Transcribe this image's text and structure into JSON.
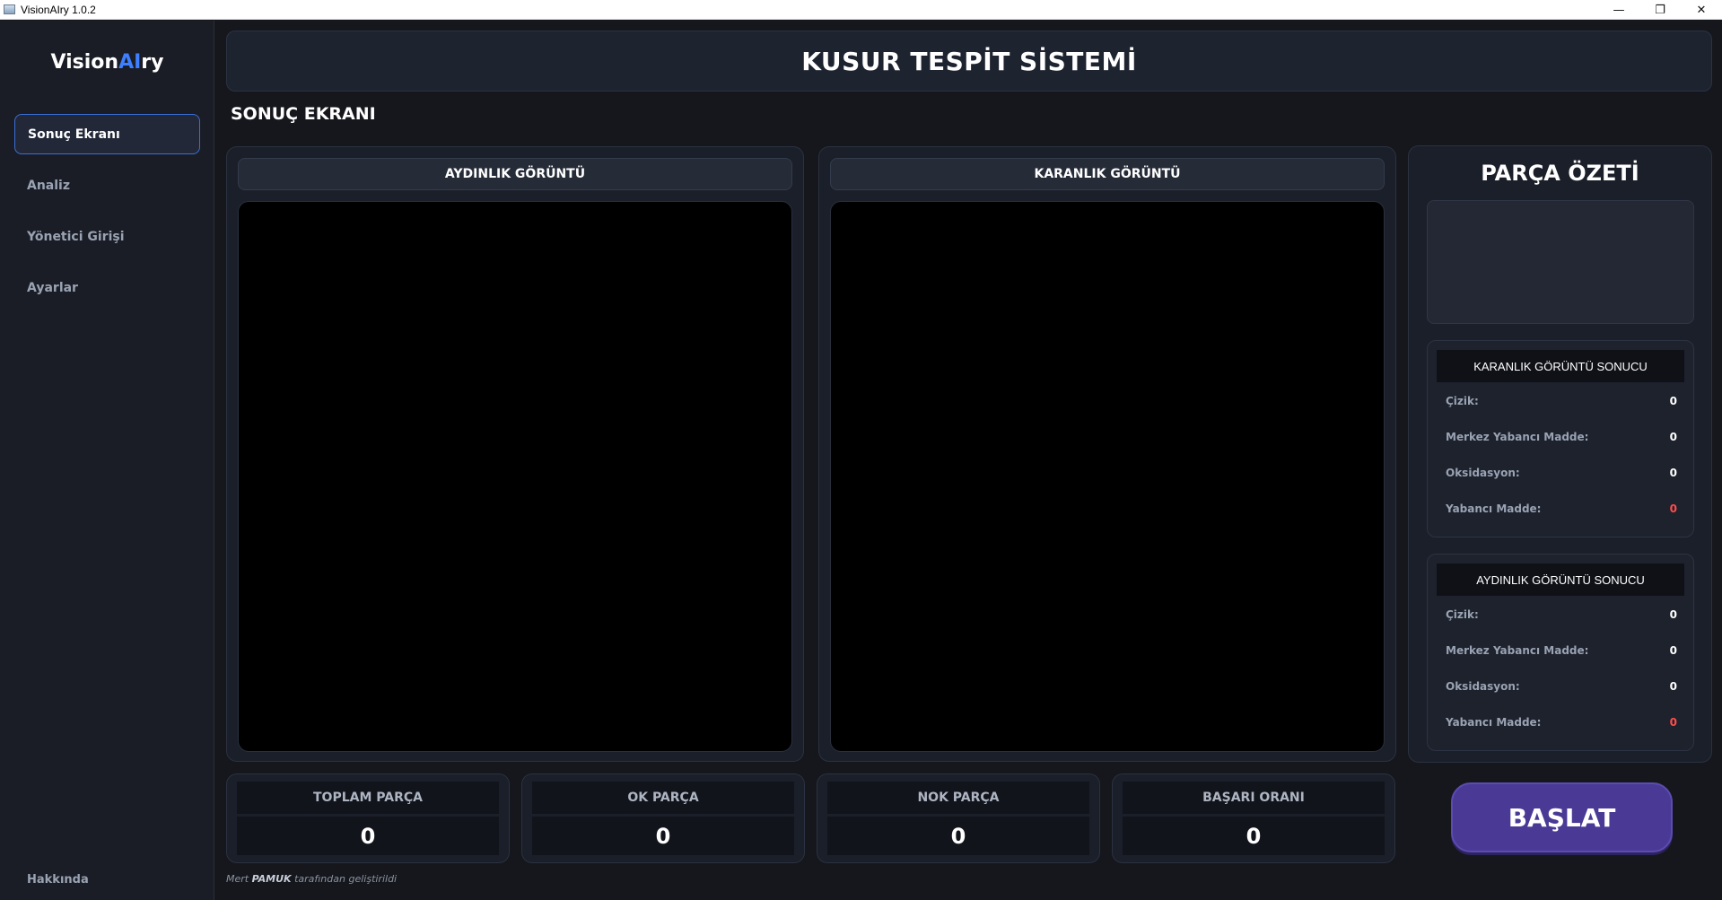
{
  "window": {
    "title": "VisionAIry 1.0.2",
    "controls": {
      "minimize": "—",
      "maximize": "❐",
      "close": "✕"
    }
  },
  "sidebar": {
    "brand_prefix": "Vision",
    "brand_ai": "AI",
    "brand_suffix": "ry",
    "items": [
      {
        "label": "Sonuç Ekranı",
        "active": true
      },
      {
        "label": "Analiz",
        "active": false
      },
      {
        "label": "Yönetici Girişi",
        "active": false
      },
      {
        "label": "Ayarlar",
        "active": false
      }
    ],
    "about": "Hakkında"
  },
  "header": {
    "title": "KUSUR TESPİT SİSTEMİ"
  },
  "section": {
    "title": "SONUÇ EKRANI"
  },
  "panels": {
    "bright": {
      "label": "AYDINLIK GÖRÜNTÜ"
    },
    "dark": {
      "label": "KARANLIK GÖRÜNTÜ"
    }
  },
  "summary": {
    "title": "PARÇA ÖZETİ",
    "dark_result": {
      "title": "KARANLIK GÖRÜNTÜ SONUCU",
      "rows": [
        {
          "label": "Çizik:",
          "value": "0"
        },
        {
          "label": "Merkez Yabancı Madde:",
          "value": "0"
        },
        {
          "label": "Oksidasyon:",
          "value": "0"
        },
        {
          "label": "Yabancı Madde:",
          "value": "0"
        }
      ]
    },
    "bright_result": {
      "title": "AYDINLIK GÖRÜNTÜ SONUCU",
      "rows": [
        {
          "label": "Çizik:",
          "value": "0"
        },
        {
          "label": "Merkez Yabancı Madde:",
          "value": "0"
        },
        {
          "label": "Oksidasyon:",
          "value": "0"
        },
        {
          "label": "Yabancı Madde:",
          "value": "0"
        }
      ]
    }
  },
  "stats": [
    {
      "label": "TOPLAM PARÇA",
      "value": "0"
    },
    {
      "label": "OK PARÇA",
      "value": "0"
    },
    {
      "label": "NOK PARÇA",
      "value": "0"
    },
    {
      "label": "BAŞARI ORANI",
      "value": "0"
    }
  ],
  "start_button": "BAŞLAT",
  "credit": {
    "name": "Mert",
    "surname": "PAMUK",
    "suffix": "tarafından geliştirildi"
  },
  "colors": {
    "accent": "#3d7fff",
    "start_button": "#4a3a96",
    "alert": "#ff4d4d"
  }
}
